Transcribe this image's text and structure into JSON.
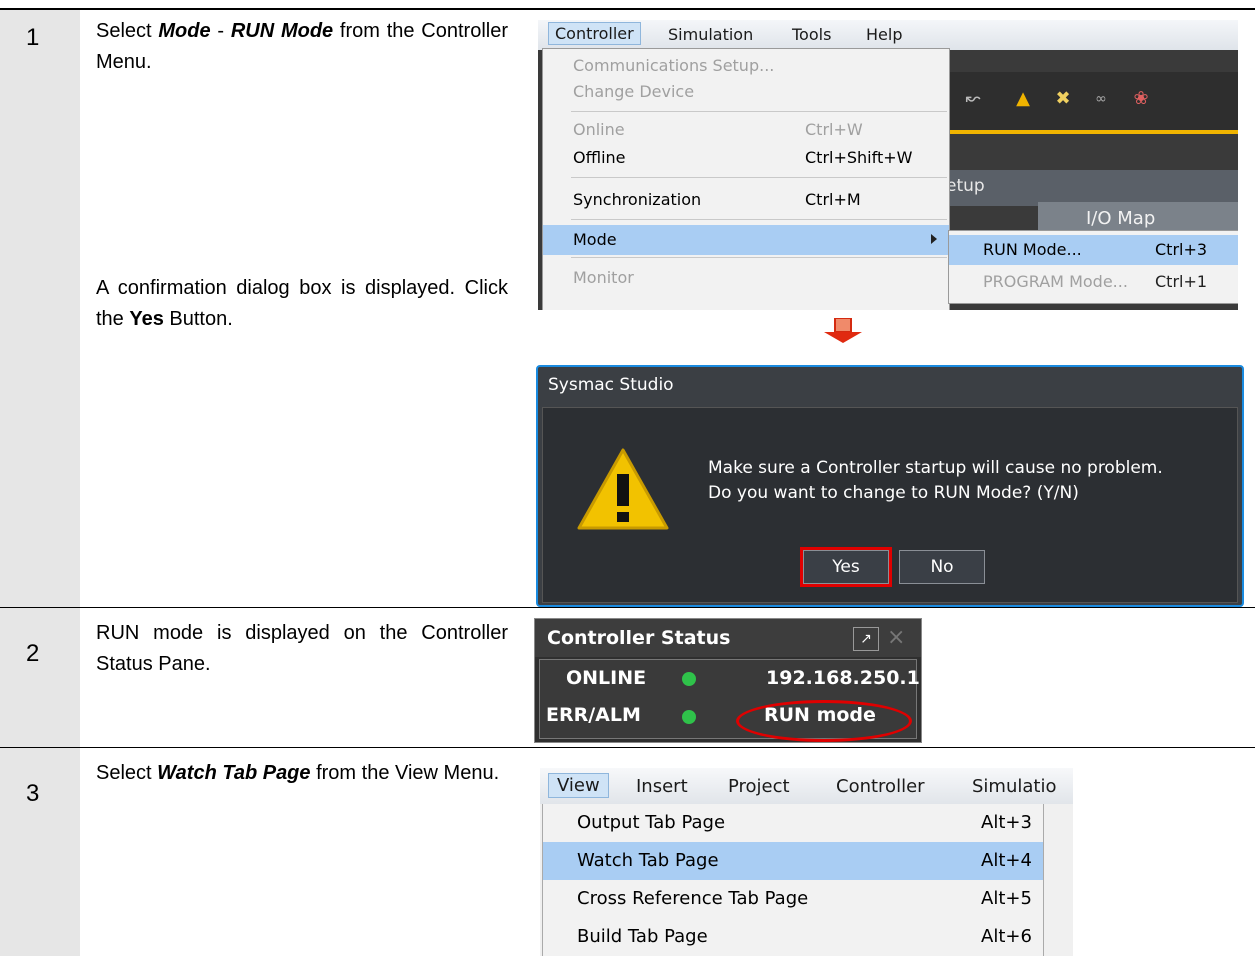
{
  "steps": [
    {
      "number": "1",
      "desc_parts": [
        "Select ",
        "Mode",
        " - ",
        "RUN Mode",
        " from the Controller Menu."
      ],
      "desc2_parts": [
        "A confirmation dialog box is displayed. Click the ",
        "Yes",
        " Button."
      ]
    },
    {
      "number": "2",
      "desc": "RUN mode is displayed on the Controller Status Pane."
    },
    {
      "number": "3",
      "desc_parts": [
        "Select ",
        "Watch Tab Page",
        " from the View Menu."
      ]
    }
  ],
  "controller_menu": {
    "bar": [
      "Controller",
      "Simulation",
      "Tools",
      "Help"
    ],
    "items": [
      {
        "label": "Communications Setup...",
        "shortcut": "",
        "disabled": true
      },
      {
        "label": "Change Device",
        "shortcut": "",
        "disabled": true
      },
      {
        "label": "Online",
        "shortcut": "Ctrl+W",
        "disabled": true
      },
      {
        "label": "Offline",
        "shortcut": "Ctrl+Shift+W",
        "disabled": false
      },
      {
        "label": "Synchronization",
        "shortcut": "Ctrl+M",
        "disabled": false
      },
      {
        "label": "Mode",
        "shortcut": "",
        "disabled": false,
        "selected": true
      },
      {
        "label": "Monitor",
        "shortcut": "",
        "disabled": true
      }
    ],
    "submenu": [
      {
        "label": "RUN Mode...",
        "shortcut": "Ctrl+3",
        "disabled": false,
        "selected": true
      },
      {
        "label": "PROGRAM Mode...",
        "shortcut": "Ctrl+1",
        "disabled": true
      }
    ],
    "background_fragments": {
      "setup_tab": "etup",
      "io_map_tab": "I/O Map"
    }
  },
  "dialog": {
    "title": "Sysmac Studio",
    "line1": "Make sure a Controller startup will cause no problem.",
    "line2": "Do you want to change to RUN Mode? (Y/N)",
    "yes": "Yes",
    "no": "No"
  },
  "status_pane": {
    "title": "Controller Status",
    "online_label": "ONLINE",
    "online_value": "192.168.250.1",
    "err_label": "ERR/ALM",
    "err_value": "RUN mode",
    "indicator_color": "#2fc24a",
    "highlight_color": "#e00000"
  },
  "view_menu": {
    "bar": [
      "View",
      "Insert",
      "Project",
      "Controller",
      "Simulatio"
    ],
    "items": [
      {
        "label": "Output Tab Page",
        "shortcut": "Alt+3",
        "selected": false
      },
      {
        "label": "Watch Tab Page",
        "shortcut": "Alt+4",
        "selected": true
      },
      {
        "label": "Cross Reference Tab Page",
        "shortcut": "Alt+5",
        "selected": false
      },
      {
        "label": "Build Tab Page",
        "shortcut": "Alt+6",
        "selected": false
      }
    ]
  }
}
